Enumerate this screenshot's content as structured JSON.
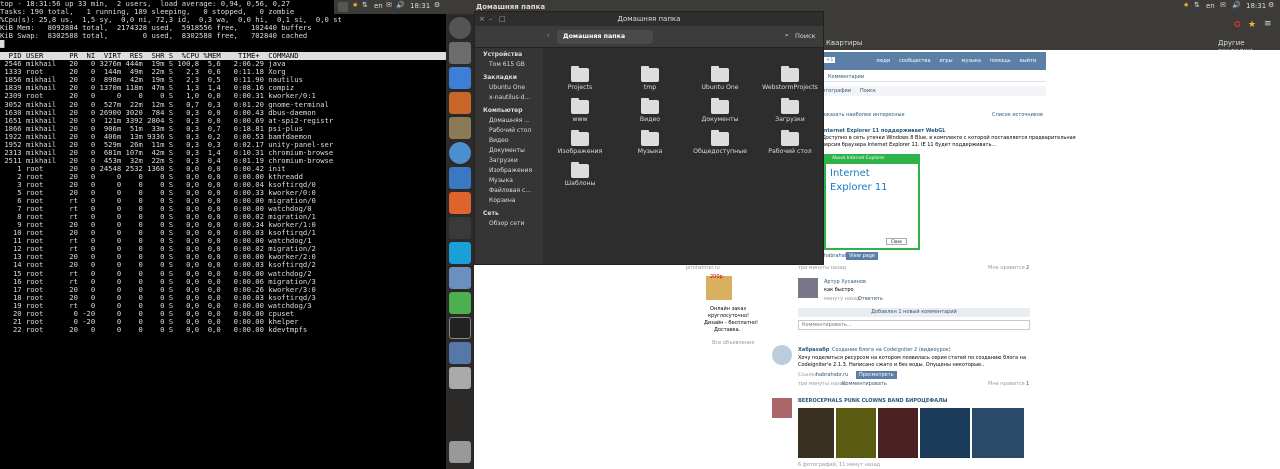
{
  "terminal": {
    "summary": [
      "top - 18:31:56 up 33 min,  2 users,  load average: 0,94, 0,56, 0,27",
      "Tasks: 190 total,   1 running, 189 sleeping,   0 stopped,   0 zombie",
      "%Cpu(s): 25,8 us,  1,5 sy,  0,0 ni, 72,3 id,  0,3 wa,  0,0 hi,  0,1 si,  0,0 st",
      "KiB Mem:   8092884 total,  2174328 used,  5918556 free,   102440 buffers",
      "KiB Swap:  8302588 total,        0 used,  8302588 free,   702840 cached"
    ],
    "header": "  PID USER      PR  NI  VIRT  RES  SHR S  %CPU %MEM    TIME+  COMMAND",
    "rows": [
      " 2546 mikhail   20   0 3276m 444m  19m S 100,8  5,6   2:06.29 java",
      " 1333 root      20   0  144m  49m  22m S   2,3  0,6   0:11.18 Xorg",
      " 1856 mikhail   20   0  898m  42m  19m S   2,3  0,5   0:11.90 nautilus",
      " 1839 mikhail   20   0 1370m 118m  47m S   1,3  1,4   0:08.16 compiz",
      " 2309 root      20   0     0    0    0 S   1,0  0,0   0:00.31 kworker/0:1",
      " 3052 mikhail   20   0  527m  22m  12m S   0,7  0,3   0:01.20 gnome-terminal",
      " 1630 mikhail   20   0 26900 3020  784 S   0,3  0,0   0:00.43 dbus-daemon",
      " 1651 mikhail   20   0  121m 3392 2804 S   0,3  0,0   0:00.69 at-spi2-registr",
      " 1866 mikhail   20   0  906m  51m  33m S   0,3  0,7   0:18.81 psi-plus",
      " 1922 mikhail   20   0  406m  13m 9336 S   0,3  0,2   0:00.53 bamfdaemon",
      " 1952 mikhail   20   0  529m  26m  11m S   0,3  0,3   0:02.17 unity-panel-ser",
      " 2313 mikhail   20   0  681m 107m  42m S   0,3  1,4   0:10.31 chromium-browse",
      " 2511 mikhail   20   0  453m  32m  22m S   0,3  0,4   0:01.19 chromium-browse",
      "    1 root      20   0 24548 2532 1368 S   0,0  0,0   0:00.42 init",
      "    2 root      20   0     0    0    0 S   0,0  0,0   0:00.00 kthreadd",
      "    3 root      20   0     0    0    0 S   0,0  0,0   0:00.04 ksoftirqd/0",
      "    5 root      20   0     0    0    0 S   0,0  0,0   0:00.33 kworker/0:0",
      "    6 root      rt   0     0    0    0 S   0,0  0,0   0:00.00 migration/0",
      "    7 root      rt   0     0    0    0 S   0,0  0,0   0:00.00 watchdog/0",
      "    8 root      rt   0     0    0    0 S   0,0  0,0   0:00.02 migration/1",
      "    9 root      20   0     0    0    0 S   0,0  0,0   0:00.34 kworker/1:0",
      "   10 root      20   0     0    0    0 S   0,0  0,0   0:00.03 ksoftirqd/1",
      "   11 root      rt   0     0    0    0 S   0,0  0,0   0:00.00 watchdog/1",
      "   12 root      rt   0     0    0    0 S   0,0  0,0   0:00.02 migration/2",
      "   13 root      20   0     0    0    0 S   0,0  0,0   0:00.00 kworker/2:0",
      "   14 root      20   0     0    0    0 S   0,0  0,0   0:00.03 ksoftirqd/2",
      "   15 root      rt   0     0    0    0 S   0,0  0,0   0:00.00 watchdog/2",
      "   16 root      rt   0     0    0    0 S   0,0  0,0   0:00.06 migration/3",
      "   17 root      20   0     0    0    0 S   0,0  0,0   0:00.26 kworker/3:0",
      "   18 root      20   0     0    0    0 S   0,0  0,0   0:00.03 ksoftirqd/3",
      "   19 root      rt   0     0    0    0 S   0,0  0,0   0:00.00 watchdog/3",
      "   20 root       0 -20     0    0    0 S   0,0  0,0   0:00.00 cpuset",
      "   21 root       0 -20     0    0    0 S   0,0  0,0   0:00.00 khelper",
      "   22 root      20   0     0    0    0 S   0,0  0,0   0:00.00 kdevtmpfs"
    ]
  },
  "panel_left": {
    "app": "Домашняя папка",
    "lang": "en",
    "time": "18:31"
  },
  "panel_right": {
    "lang": "en",
    "time": "18:31"
  },
  "nautilus": {
    "title": "Домашняя папка",
    "location": "Домашняя папка",
    "search_label": "Поиск",
    "sidebar": {
      "devices_title": "Устройства",
      "devices": [
        "Том 615 GB"
      ],
      "bookmarks_title": "Закладки",
      "bookmarks": [
        "Ubuntu One",
        "x-nautilus-d..."
      ],
      "computer_title": "Компьютер",
      "computer": [
        "Домашняя ...",
        "Рабочий стол",
        "Видео",
        "Документы",
        "Загрузки",
        "Изображения",
        "Музыка",
        "Файловая с...",
        "Корзина"
      ],
      "network_title": "Сеть",
      "network": [
        "Обзор сети"
      ]
    },
    "folders": [
      "Projects",
      "tmp",
      "Ubuntu One",
      "WebstormProjects",
      "www",
      "Видео",
      "Документы",
      "Загрузки",
      "Изображения",
      "Музыка",
      "Общедоступные",
      "Рабочий стол",
      "Шаблоны"
    ]
  },
  "browser": {
    "bookmark_item": "Квартиры",
    "other_bookmarks": "Другие закладки",
    "vk_menu": [
      "люди",
      "сообщества",
      "игры",
      "музыка",
      "помощь",
      "выйти"
    ],
    "tabs": [
      "Комментарии"
    ],
    "subtabs": [
      "Фотографии",
      "Поиск"
    ],
    "suggest": "Показать наиболее интересные",
    "sources": "Список источников",
    "post1": {
      "title": "Internet Explorer 11 поддерживает WebGL",
      "text1": "Доступно в сеть утечки Windows 8 Blue, в комплекте с которой поставляется предварительная",
      "text2": "версия браузера Internet Explorer 11. IE 11 будет поддерживать...",
      "dialog_title": "About Internet Explorer",
      "ie_name": "Internet",
      "ie_name2": "Explorer 11",
      "close_btn": "Close",
      "link": "habrahabr.ru",
      "view_btn": "View page",
      "likes": "Мне нравится",
      "likes_count": "2"
    },
    "comment1": {
      "author": "Артур Хусаинов",
      "text": "как быстро",
      "time": "минуту назад",
      "reply": "Ответить"
    },
    "added_comment": "Добавлен 1 новый комментарий",
    "comment_placeholder": "Комментировать...",
    "post2": {
      "source": "Хабрахабр",
      "title": "Создание блога на Codeigniter 2 (видеоурок)",
      "text1": "Хочу поделиться ресурсом на котором появилась серия статей по созданию блога на",
      "text2": "Codeigniter'e 2.1.3. Написано сжато и без воды. Опущены некоторые..",
      "link_label": "Ссылка",
      "link": "habrahabr.ru",
      "view_btn": "Просмотреть",
      "time": "три минуты назад",
      "comment": "Комментировать",
      "likes": "Мне нравится",
      "likes_count": "1"
    },
    "post3": {
      "title": "BEEROCEPHALS PUNK CLOWNS BAND БИРОЦЕФАЛЫ",
      "footer": "6 фотографий, 11 минут назад"
    },
    "ad": {
      "price": "200р.",
      "text1": "Онлайн заказ",
      "text2": "круглосуточно!",
      "text3": "Дизайн - бесплатно!",
      "text4": "Доставка.",
      "all_ads": "Все объявления",
      "site": "printwinter.ru"
    },
    "time_label": "три минуты назад"
  }
}
